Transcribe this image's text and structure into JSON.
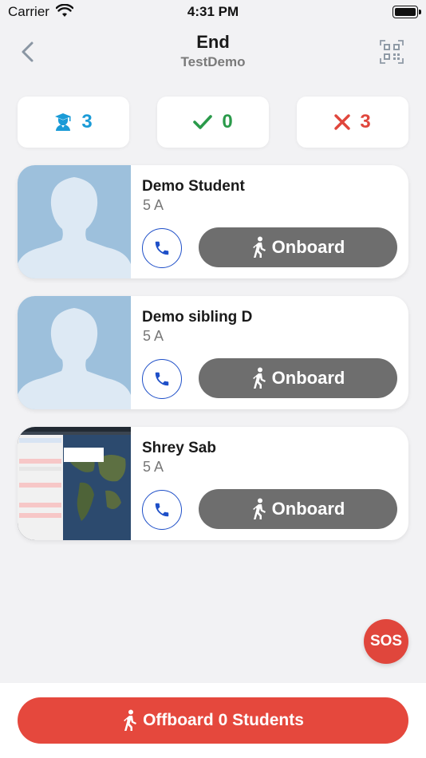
{
  "status_bar": {
    "carrier": "Carrier",
    "time": "4:31 PM"
  },
  "header": {
    "title": "End",
    "subtitle": "TestDemo"
  },
  "summary": {
    "total": "3",
    "onboard": "0",
    "absent": "3",
    "colors": {
      "total": "#1a9bd7",
      "onboard": "#2a9a4a",
      "absent": "#e0463c"
    }
  },
  "students": [
    {
      "name": "Demo Student",
      "class": "5 A",
      "action_label": "Onboard",
      "photo": "avatar-placeholder"
    },
    {
      "name": "Demo sibling D",
      "class": "5 A",
      "action_label": "Onboard",
      "photo": "avatar-placeholder"
    },
    {
      "name": "Shrey Sab",
      "class": "5 A",
      "action_label": "Onboard",
      "photo": "screenshot-thumbnail"
    }
  ],
  "sos": {
    "label": "SOS",
    "color": "#e0463c"
  },
  "footer": {
    "offboard_label": "Offboard 0 Students",
    "color": "#e5483d"
  },
  "icons": {
    "back": "chevron-left-icon",
    "qr": "qr-code-icon",
    "student": "graduate-icon",
    "check": "check-icon",
    "cross": "close-icon",
    "phone": "phone-icon",
    "walk": "walking-person-icon"
  }
}
